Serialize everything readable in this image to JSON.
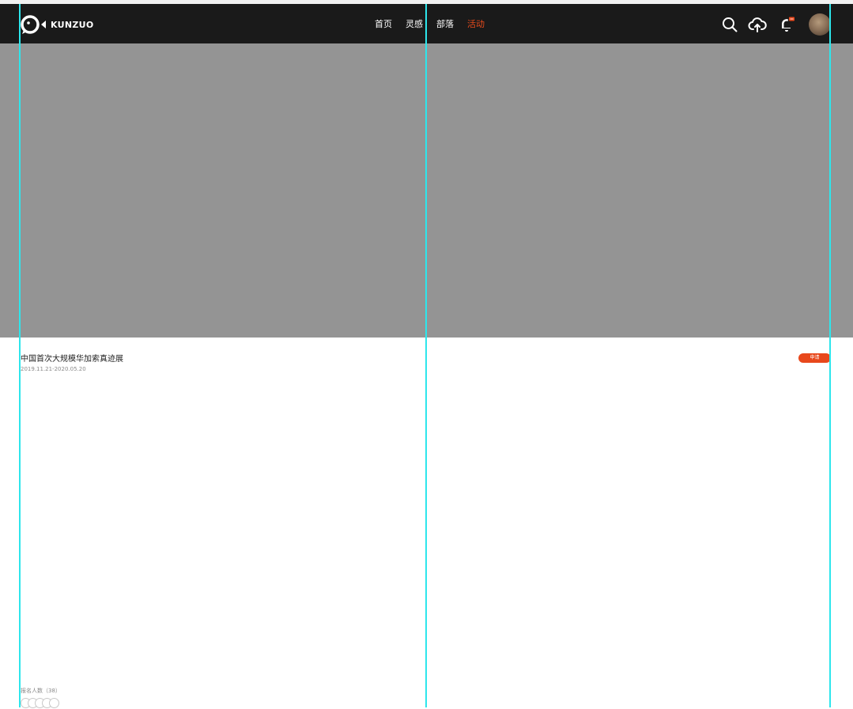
{
  "brand": {
    "name": "KUNZUO",
    "logo_icon": "kunzuo-logo-icon"
  },
  "nav": {
    "items": [
      {
        "label": "首页",
        "active": false
      },
      {
        "label": "灵感",
        "active": false
      },
      {
        "label": "部落",
        "active": false
      },
      {
        "label": "活动",
        "active": true
      }
    ],
    "active_color": "#e84b1c"
  },
  "actions": {
    "icons": [
      "search-icon",
      "cloud-upload-icon",
      "bell-icon",
      "user-avatar"
    ]
  },
  "event": {
    "title": "中国首次大规模华加索真迹展",
    "dates": "2019.11.21-2020.05.20",
    "apply_label": "申请",
    "signup_label": "报名人数（38）"
  },
  "colors": {
    "navbar": "#1a1a1a",
    "banner": "#949494",
    "accent": "#e8481c",
    "guide_lines": "#2de6ec"
  }
}
